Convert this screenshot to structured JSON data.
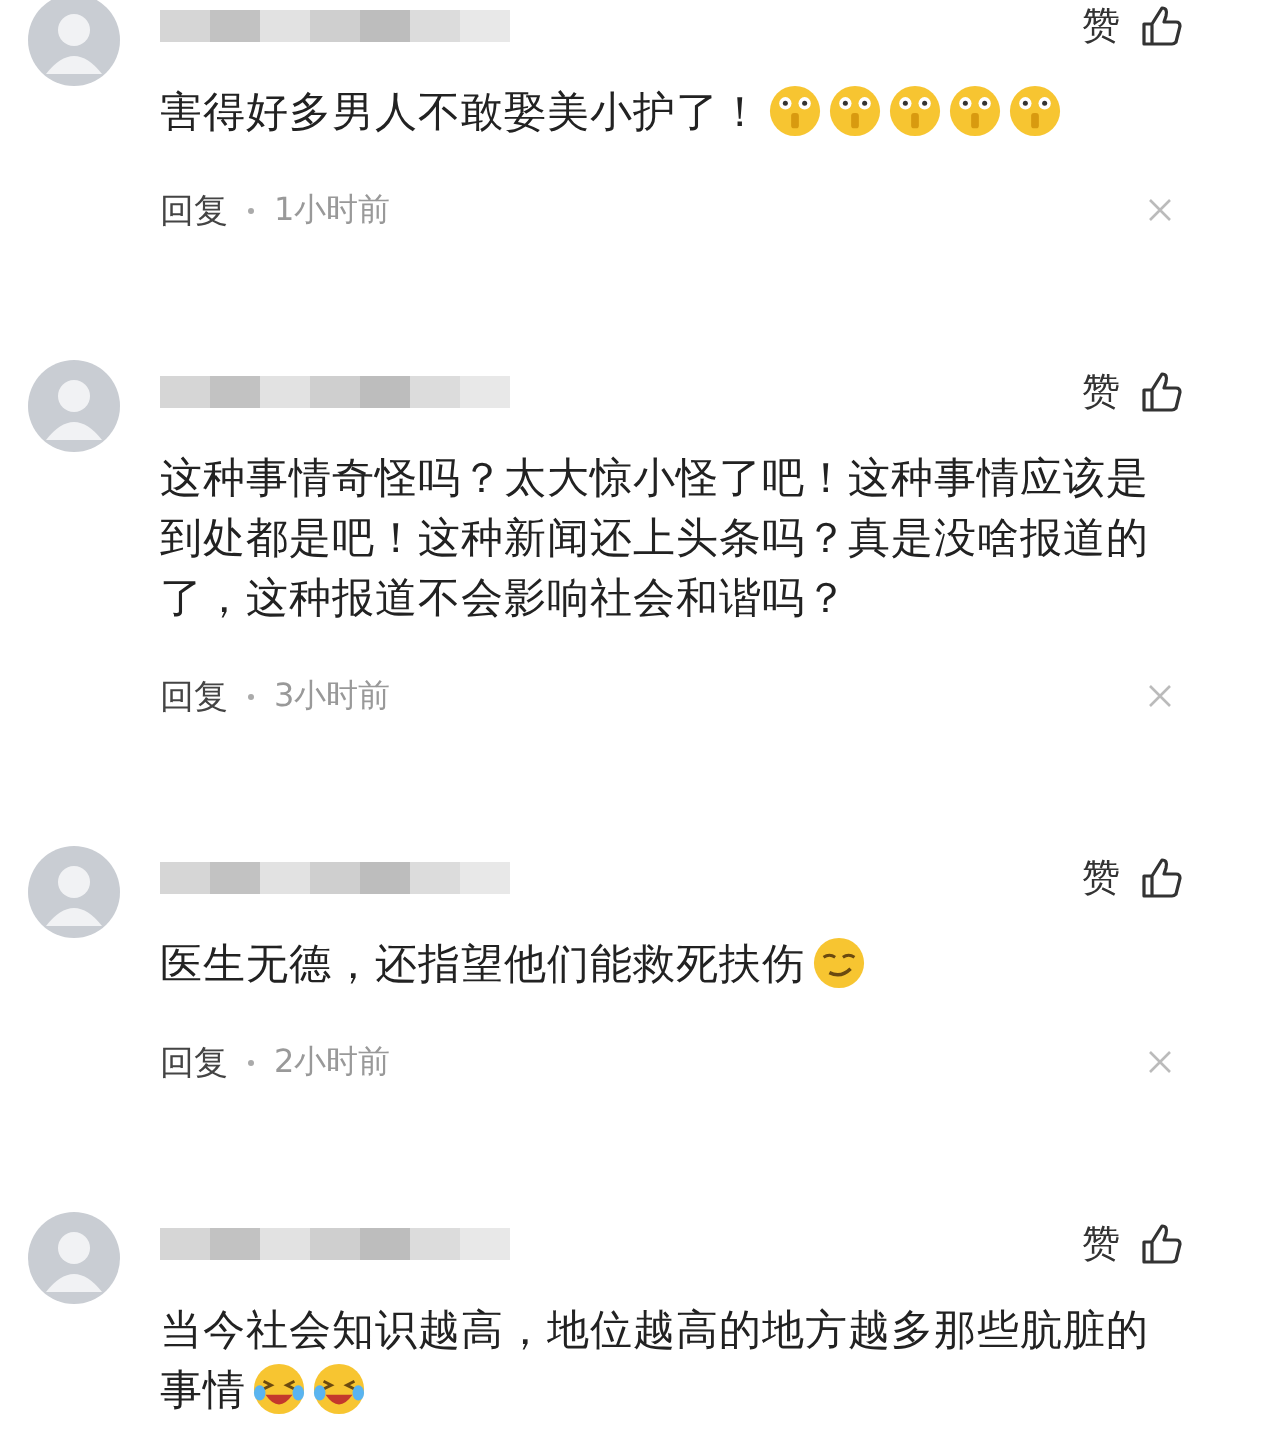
{
  "comments": [
    {
      "like": "赞",
      "text": "害得好多男人不敢娶美小护了！",
      "emojis": [
        {
          "kind": "grimace"
        },
        {
          "kind": "grimace"
        },
        {
          "kind": "grimace"
        },
        {
          "kind": "grimace"
        },
        {
          "kind": "grimace"
        }
      ],
      "reply": "回复",
      "time": "1小时前"
    },
    {
      "like": "赞",
      "text": "这种事情奇怪吗？太大惊小怪了吧！这种事情应该是到处都是吧！这种新闻还上头条吗？真是没啥报道的了，这种报道不会影响社会和谐吗？",
      "reply": "回复",
      "time": "3小时前"
    },
    {
      "like": "赞",
      "text": "医生无德，还指望他们能救死扶伤",
      "emojis": [
        {
          "kind": "smirk"
        }
      ],
      "reply": "回复",
      "time": "2小时前"
    },
    {
      "like": "赞",
      "text": "当今社会知识越高，地位越高的地方越多那些肮脏的事情",
      "emojis": [
        {
          "kind": "laugh-cry"
        },
        {
          "kind": "laugh-cry"
        }
      ]
    }
  ]
}
